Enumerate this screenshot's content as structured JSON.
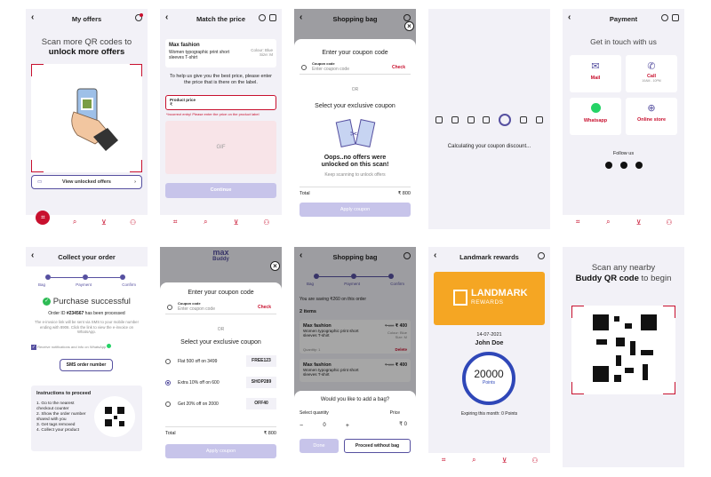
{
  "offers": {
    "title": "My offers",
    "headline_1": "Scan more QR codes to",
    "headline_2": "unlock more offers",
    "view_unlocked": "View unlocked offers"
  },
  "match": {
    "title": "Match the price",
    "brand": "Max fashion",
    "product": "Women typographic print short sleeves T-shirt",
    "colour": "Colour: Blue",
    "size": "Size: M",
    "help": "To help us give you the best price, please enter the price that is there on the label.",
    "price_label": "Product price",
    "price_prefix": "₹",
    "error": "*Incorrect entry! Please enter the price on the product label",
    "gif": "GIF",
    "continue": "Continue"
  },
  "bag1": {
    "title": "Shopping bag",
    "enter_coupon": "Enter your coupon code",
    "coupon_label": "Coupon code",
    "coupon_placeholder": "Enter coupon code",
    "check": "Check",
    "or": "OR",
    "select_exclusive": "Select your exclusive coupon",
    "oops_1": "Oops..no offers were",
    "oops_2": "unlocked on this scan!",
    "keep": "Keep scanning to unlock offers",
    "total_label": "Total",
    "total": "₹ 800",
    "apply": "Apply coupon"
  },
  "calc": {
    "text": "Calculating your coupon discount..."
  },
  "payment": {
    "title": "Payment",
    "touch": "Get in touch with us",
    "mail": "Mail",
    "call": "Call",
    "call_hours": "10AM - 10PM",
    "whatsapp": "Whatsapp",
    "online": "Online store",
    "follow": "Follow us"
  },
  "collect": {
    "title": "Collect your order",
    "steps": [
      "Bag",
      "Payment",
      "Confirm"
    ],
    "success": "Purchase successful",
    "order_prefix": "Order ID ",
    "order_id": "#234567",
    "order_suffix": " has been processed",
    "einvoice": "The e-invoice link will be sent via SMS to your mobile number ending with 8906. Click the link to view the e-invoice on WhatsApp.",
    "receive": "Receive notifications and info on WhatsApp",
    "sms_btn": "SMS order number",
    "instr_title": "Instructions to proceed",
    "instr": [
      "1. Go to the nearest checkout counter",
      "2. Show the order number shared with you",
      "3. Get tags removed",
      "4. Collect your product"
    ]
  },
  "buddy_coupons": {
    "logo_top": "max",
    "logo_bottom": "Buddy",
    "enter_coupon": "Enter your coupon code",
    "coupon_label": "Coupon code",
    "coupon_placeholder": "Enter coupon code",
    "check": "Check",
    "or": "OR",
    "select_exclusive": "Select your exclusive coupon",
    "options": [
      {
        "label": "Flat 500 off on 3499",
        "code": "FREE123"
      },
      {
        "label": "Extra 10% off on 600",
        "code": "SHOP289"
      },
      {
        "label": "Get 20% off on 2000",
        "code": "OFF40"
      }
    ],
    "total_label": "Total",
    "total": "₹ 800",
    "apply": "Apply coupon"
  },
  "bag2": {
    "title": "Shopping bag",
    "steps": [
      "Bag",
      "Payment",
      "Confirm"
    ],
    "saving": "You are saving ₹260 on this order",
    "items": "2 items",
    "item_brand": "Max fashion",
    "item_name": "Women typographic print short sleeves T-shirt",
    "item_old": "₹ 600",
    "item_price": "₹ 400",
    "colour": "Colour: Blue",
    "size": "Size: M",
    "qty": "Quantity: 1",
    "delete": "Delete",
    "add_bag": "Would you like to add a bag?",
    "select_qty": "Select quantity",
    "price": "Price",
    "qty_val": "0",
    "price_val": "₹ 0",
    "done": "Done",
    "proceed": "Proceed without bag"
  },
  "rewards": {
    "title": "Landmark rewards",
    "brand_1": "LANDMARK",
    "brand_2": "REWARDS",
    "date": "14-07-2021",
    "name": "John Doe",
    "points": "20000",
    "points_label": "Points",
    "expiring": "Expiring this month: 0 Points"
  },
  "scan": {
    "line_1": "Scan any nearby",
    "line_2_bold": "Buddy QR code",
    "line_2_rest": " to begin"
  },
  "colors": {
    "accent": "#c8102e",
    "primary": "#5650a0",
    "orange": "#f5a623"
  }
}
